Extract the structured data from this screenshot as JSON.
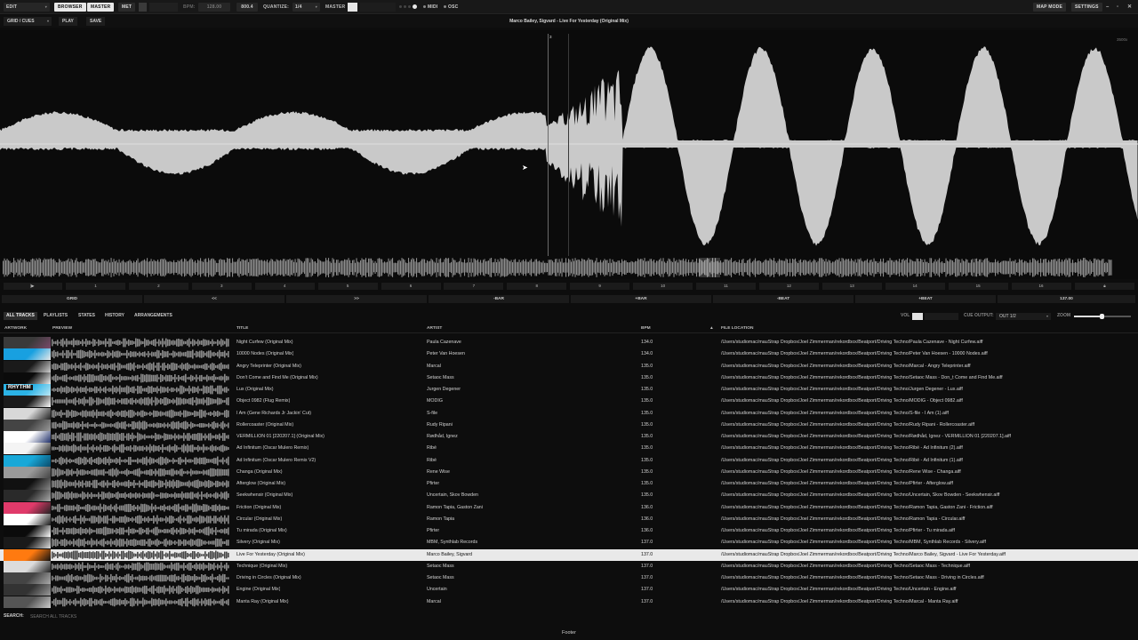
{
  "topbar": {
    "edit_label": "EDIT",
    "browser_label": "BROWSER",
    "master_label": "MASTER",
    "met_label": "MET",
    "bpm_label": "BPM:",
    "bpm_value": "128.00",
    "counter_value": "800.4",
    "quantize_label": "QUANTIZE:",
    "quantize_value": "1/4",
    "master_out_label": "MASTER",
    "midi_label": "MIDI",
    "osc_label": "OSC",
    "map_mode_label": "MAP MODE",
    "settings_label": "SETTINGS"
  },
  "subbar": {
    "mode_label": "GRID / CUES",
    "play_label": "PLAY",
    "save_label": "SAVE",
    "track_title": "Marco Bailey, Sigvard - Live For Yesterday (Original Mix)"
  },
  "waveform": {
    "zoom_readout": "3500x",
    "marker_label": "3"
  },
  "beat_markers": [
    "1",
    "2",
    "3",
    "4",
    "5",
    "6",
    "7",
    "8",
    "9",
    "10",
    "11",
    "12",
    "13",
    "14",
    "15",
    "16"
  ],
  "controls": {
    "grid": "GRID",
    "back": "<<",
    "forward": ">>",
    "minus_bar": "-BAR",
    "plus_bar": "+BAR",
    "minus_beat": "-BEAT",
    "plus_beat": "+BEAT",
    "bpm": "137.00"
  },
  "library_tabs": [
    "ALL TRACKS",
    "PLAYLISTS",
    "STATES",
    "HISTORY",
    "ARRANGEMENTS"
  ],
  "library_right": {
    "vol_label": "VOL",
    "cue_output_label": "CUE OUTPUT:",
    "cue_output_value": "OUT 1/2",
    "zoom_label": "ZOOM"
  },
  "columns": {
    "artwork": "ARTWORK",
    "preview": "PREVIEW",
    "title": "TITLE",
    "artist": "ARTIST",
    "bpm": "BPM",
    "file_location": "FILE LOCATION"
  },
  "tracks": [
    {
      "title": "Night Curfew (Original Mix)",
      "artist": "Paula Cazenave",
      "bpm": "134.0",
      "file": "/Users/studiomac/mauStrap Dropbox/Joel Zimmerman/rekordbox/Beatport/Driving Techno/Paula Cazenave - Night Curfew.aiff"
    },
    {
      "title": "10000 Nodes (Original Mix)",
      "artist": "Peter Van Hoesen",
      "bpm": "134.0",
      "file": "/Users/studiomac/mauStrap Dropbox/Joel Zimmerman/rekordbox/Beatport/Driving Techno/Peter Van Hoesen - 10000 Nodes.aiff"
    },
    {
      "title": "Angry Teleprinter (Original Mix)",
      "artist": "Marcal",
      "bpm": "135.0",
      "file": "/Users/studiomac/mauStrap Dropbox/Joel Zimmerman/rekordbox/Beatport/Driving Techno/Marcal - Angry Teleprinter.aiff"
    },
    {
      "title": "Don't Come and Find Me (Original Mix)",
      "artist": "Setaoc Mass",
      "bpm": "135.0",
      "file": "/Users/studiomac/mauStrap Dropbox/Joel Zimmerman/rekordbox/Beatport/Driving Techno/Setaoc Mass - Don_t Come and Find Me.aiff"
    },
    {
      "title": "Lux (Original Mix)",
      "artist": "Jurgen Degener",
      "bpm": "135.0",
      "file": "/Users/studiomac/mauStrap Dropbox/Joel Zimmerman/rekordbox/Beatport/Driving Techno/Jurgen Degener - Lux.aiff"
    },
    {
      "title": "Object 0982 (Flug Remix)",
      "artist": "MODIG",
      "bpm": "135.0",
      "file": "/Users/studiomac/mauStrap Dropbox/Joel Zimmerman/rekordbox/Beatport/Driving Techno/MODIG - Object 0982.aiff"
    },
    {
      "title": "I Am (Gene Richards Jr Jackin' Cut)",
      "artist": "S-file",
      "bpm": "135.0",
      "file": "/Users/studiomac/mauStrap Dropbox/Joel Zimmerman/rekordbox/Beatport/Driving Techno/S-file - I Am (1).aiff"
    },
    {
      "title": "Rollercoaster (Original Mix)",
      "artist": "Rudy Ripani",
      "bpm": "135.0",
      "file": "/Users/studiomac/mauStrap Dropbox/Joel Zimmerman/rekordbox/Beatport/Driving Techno/Rudy Ripani - Rollercoaster.aiff"
    },
    {
      "title": "VERMILLION 01 [220207.1] (Original Mix)",
      "artist": "Rødhåd, Ignez",
      "bpm": "135.0",
      "file": "/Users/studiomac/mauStrap Dropbox/Joel Zimmerman/rekordbox/Beatport/Driving Techno/Rødhåd, Ignez - VERMILLION 01 [220207.1].aiff"
    },
    {
      "title": "Ad Infinitum (Oscar Mulero Remix)",
      "artist": "Ribé",
      "bpm": "135.0",
      "file": "/Users/studiomac/mauStrap Dropbox/Joel Zimmerman/rekordbox/Beatport/Driving Techno/Ribé - Ad Infinitum (2).aiff"
    },
    {
      "title": "Ad Infinitum (Oscar Mulero Remix V2)",
      "artist": "Ribé",
      "bpm": "135.0",
      "file": "/Users/studiomac/mauStrap Dropbox/Joel Zimmerman/rekordbox/Beatport/Driving Techno/Ribé - Ad Infinitum (1).aiff"
    },
    {
      "title": "Changa (Original Mix)",
      "artist": "Rene Wise",
      "bpm": "135.0",
      "file": "/Users/studiomac/mauStrap Dropbox/Joel Zimmerman/rekordbox/Beatport/Driving Techno/Rene Wise - Changa.aiff"
    },
    {
      "title": "Afterglow (Original Mix)",
      "artist": "Pfirter",
      "bpm": "135.0",
      "file": "/Users/studiomac/mauStrap Dropbox/Joel Zimmerman/rekordbox/Beatport/Driving Techno/Pfirter - Afterglow.aiff"
    },
    {
      "title": "Seekwhensir (Original Mix)",
      "artist": "Uncertain, Skov Bowden",
      "bpm": "135.0",
      "file": "/Users/studiomac/mauStrap Dropbox/Joel Zimmerman/rekordbox/Beatport/Driving Techno/Uncertain, Skov Bowden - Seekwhensir.aiff"
    },
    {
      "title": "Friction (Original Mix)",
      "artist": "Ramon Tapia, Gaston Zani",
      "bpm": "136.0",
      "file": "/Users/studiomac/mauStrap Dropbox/Joel Zimmerman/rekordbox/Beatport/Driving Techno/Ramon Tapia, Gaston Zani - Friction.aiff"
    },
    {
      "title": "Circular (Original Mix)",
      "artist": "Ramon Tapia",
      "bpm": "136.0",
      "file": "/Users/studiomac/mauStrap Dropbox/Joel Zimmerman/rekordbox/Beatport/Driving Techno/Ramon Tapia - Circular.aiff"
    },
    {
      "title": "Tu mirada (Original Mix)",
      "artist": "Pfirter",
      "bpm": "136.0",
      "file": "/Users/studiomac/mauStrap Dropbox/Joel Zimmerman/rekordbox/Beatport/Driving Techno/Pfirter - Tu mirada.aiff"
    },
    {
      "title": "Silvery (Original Mix)",
      "artist": "MBM, Synthlab Records",
      "bpm": "137.0",
      "file": "/Users/studiomac/mauStrap Dropbox/Joel Zimmerman/rekordbox/Beatport/Driving Techno/MBM, Synthlab Records - Silvery.aiff"
    },
    {
      "title": "Live For Yesterday (Original Mix)",
      "artist": "Marco Bailey, Sigvard",
      "bpm": "137.0",
      "file": "/Users/studiomac/mauStrap Dropbox/Joel Zimmerman/rekordbox/Beatport/Driving Techno/Marco Bailey, Sigvard - Live For Yesterday.aiff",
      "selected": true
    },
    {
      "title": "Technique (Original Mix)",
      "artist": "Setaoc Mass",
      "bpm": "137.0",
      "file": "/Users/studiomac/mauStrap Dropbox/Joel Zimmerman/rekordbox/Beatport/Driving Techno/Setaoc Mass - Technique.aiff"
    },
    {
      "title": "Driving in Circles (Original Mix)",
      "artist": "Setaoc Mass",
      "bpm": "137.0",
      "file": "/Users/studiomac/mauStrap Dropbox/Joel Zimmerman/rekordbox/Beatport/Driving Techno/Setaoc Mass - Driving in Circles.aiff"
    },
    {
      "title": "Engine (Original Mix)",
      "artist": "Uncertain",
      "bpm": "137.0",
      "file": "/Users/studiomac/mauStrap Dropbox/Joel Zimmerman/rekordbox/Beatport/Driving Techno/Uncertain - Engine.aiff"
    },
    {
      "title": "Manta Ray (Original Mix)",
      "artist": "Marcal",
      "bpm": "137.0",
      "file": "/Users/studiomac/mauStrap Dropbox/Joel Zimmerman/rekordbox/Beatport/Driving Techno/Marcal - Manta Ray.aiff"
    }
  ],
  "artwork_label": "RHYTHM",
  "search": {
    "label": "SEARCH:",
    "placeholder": "SEARCH ALL TRACKS"
  },
  "footer": "Footer",
  "colors": {
    "selected_row": "#e9e9e9",
    "waveform": "#c9c9c9",
    "background": "#0d0d0d"
  }
}
